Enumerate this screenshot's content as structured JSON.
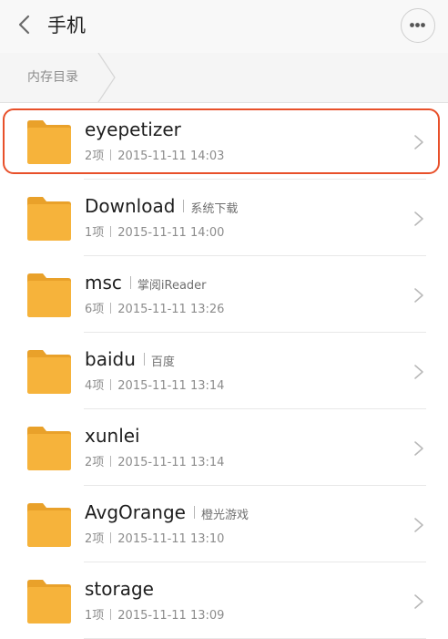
{
  "header": {
    "title": "手机",
    "back_icon": "chevron-left-icon",
    "more_icon": "more-horizontal-icon"
  },
  "breadcrumb": {
    "items": [
      "内存目录"
    ]
  },
  "colors": {
    "folder": "#f6b33b",
    "folder_tab": "#e9a12a",
    "highlight": "#e8502a"
  },
  "files": [
    {
      "name": "eyepetizer",
      "alias": "",
      "count": "2项",
      "date": "2015-11-11 14:03",
      "highlighted": true
    },
    {
      "name": "Download",
      "alias": "系统下载",
      "count": "1项",
      "date": "2015-11-11 14:00"
    },
    {
      "name": "msc",
      "alias": "掌阅iReader",
      "count": "6项",
      "date": "2015-11-11 13:26"
    },
    {
      "name": "baidu",
      "alias": "百度",
      "count": "4项",
      "date": "2015-11-11 13:14"
    },
    {
      "name": "xunlei",
      "alias": "",
      "count": "2项",
      "date": "2015-11-11 13:14"
    },
    {
      "name": "AvgOrange",
      "alias": "橙光游戏",
      "count": "2项",
      "date": "2015-11-11 13:10"
    },
    {
      "name": "storage",
      "alias": "",
      "count": "1项",
      "date": "2015-11-11 13:09"
    }
  ]
}
